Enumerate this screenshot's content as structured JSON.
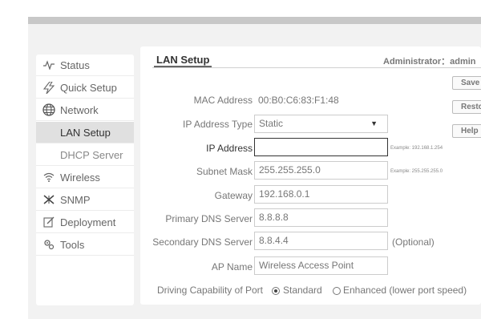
{
  "header": {
    "title": "LAN Setup",
    "admin_label": "Administrator：",
    "admin_user": "admin"
  },
  "side_buttons": {
    "save": "Save",
    "restore": "Restore",
    "help": "Help"
  },
  "sidebar": {
    "items": [
      {
        "label": "Status",
        "icon": "pulse-icon"
      },
      {
        "label": "Quick Setup",
        "icon": "lightning-icon"
      },
      {
        "label": "Network",
        "icon": "globe-icon"
      },
      {
        "label": "LAN Setup",
        "icon": ""
      },
      {
        "label": "DHCP Server",
        "icon": ""
      },
      {
        "label": "Wireless",
        "icon": "wifi-icon"
      },
      {
        "label": "SNMP",
        "icon": "snmp-icon"
      },
      {
        "label": "Deployment",
        "icon": "edit-icon"
      },
      {
        "label": "Tools",
        "icon": "gear-icon"
      }
    ]
  },
  "form": {
    "mac_label": "MAC Address",
    "mac_value": "00:B0:C6:83:F1:48",
    "ip_type_label": "IP Address Type",
    "ip_type_value": "Static",
    "ip_label": "IP Address",
    "ip_value": "",
    "ip_example": "Example: 192.168.1.254",
    "subnet_label": "Subnet Mask",
    "subnet_value": "255.255.255.0",
    "subnet_example": "Example: 255.255.255.0",
    "gateway_label": "Gateway",
    "gateway_value": "192.168.0.1",
    "dns1_label": "Primary DNS Server",
    "dns1_value": "8.8.8.8",
    "dns2_label": "Secondary DNS Server",
    "dns2_value": "8.8.4.4",
    "dns2_optional": "(Optional)",
    "ap_label": "AP Name",
    "ap_value": "Wireless Access Point",
    "drive_label": "Driving Capability of Port",
    "drive_options": [
      "Standard",
      "Enhanced (lower port speed)"
    ],
    "drive_selected": "Standard"
  },
  "colors": {
    "active_nav_bg": "#e0e0e0",
    "page_bg": "#f2f2f2",
    "top_bar": "#c8c8c8"
  }
}
